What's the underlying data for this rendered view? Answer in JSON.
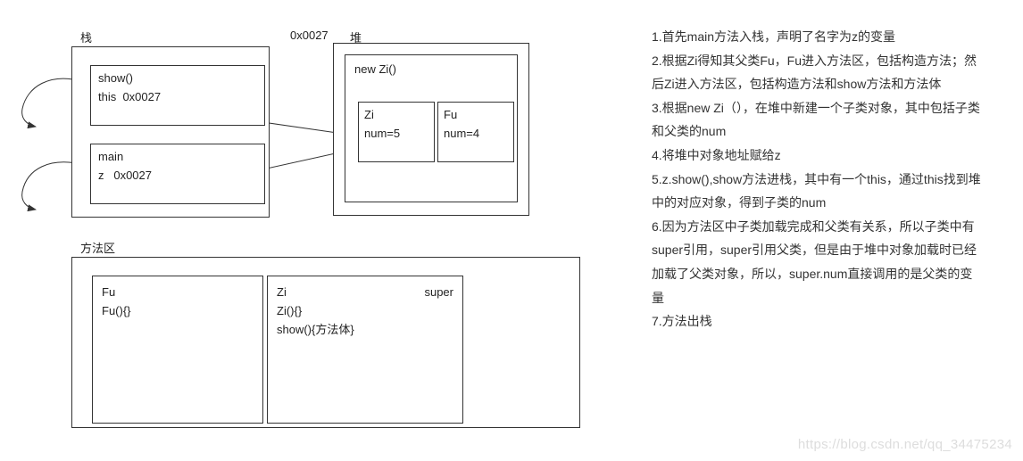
{
  "labels": {
    "stack": "栈",
    "heap": "堆",
    "heap_addr": "0x0027",
    "method_area": "方法区"
  },
  "stack": {
    "frame_show": {
      "line1": "show()",
      "line2": "this  0x0027"
    },
    "frame_main": {
      "line1": "main",
      "line2": "z   0x0027"
    }
  },
  "heap": {
    "title": "new Zi()",
    "zi": {
      "name": "Zi",
      "field": "num=5"
    },
    "fu": {
      "name": "Fu",
      "field": "num=4"
    }
  },
  "method_area": {
    "fu_box": {
      "name": "Fu",
      "ctor": "Fu(){}"
    },
    "zi_box": {
      "name": "Zi",
      "super": "super",
      "ctor": "Zi(){}",
      "method": "show(){方法体}"
    }
  },
  "explain": {
    "p1": "1.首先main方法入栈，声明了名字为z的变量",
    "p2": "2.根据Zi得知其父类Fu，Fu进入方法区，包括构造方法；然后Zi进入方法区，包括构造方法和show方法和方法体",
    "p3": "3.根据new Zi（），在堆中新建一个子类对象，其中包括子类和父类的num",
    "p4": "4.将堆中对象地址赋给z",
    "p5": "5.z.show(),show方法进栈，其中有一个this，通过this找到堆中的对应对象，得到子类的num",
    "p6": "6.因为方法区中子类加载完成和父类有关系，所以子类中有super引用，super引用父类，但是由于堆中对象加载时已经加载了父类对象，所以，super.num直接调用的是父类的变量",
    "p7": "7.方法出栈"
  },
  "watermark": "https://blog.csdn.net/qq_34475234"
}
